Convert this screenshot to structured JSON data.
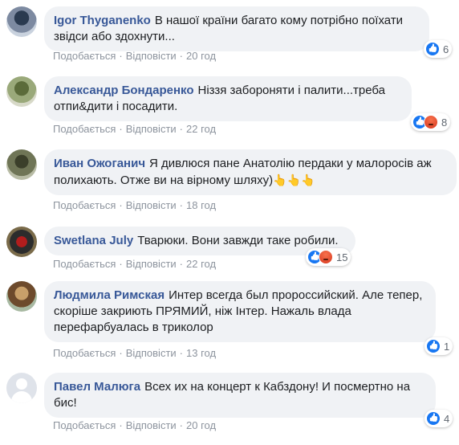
{
  "action_labels": {
    "like": "Подобається",
    "reply": "Відповісти",
    "separator": "·"
  },
  "comments": [
    {
      "author": "Igor Thyganenko",
      "text": "В нашої країни багато кому потрібно поїхати звідси або здохнути...",
      "time": "20 год",
      "reactions": [
        "like"
      ],
      "reaction_count": "6"
    },
    {
      "author": "Александр Бондаренко",
      "text": "Ніззя забороняти і палити...треба отпи&дити і посадити.",
      "time": "22 год",
      "reactions": [
        "like",
        "angry"
      ],
      "reaction_count": "8"
    },
    {
      "author": "Иван Ожоганич",
      "text": "Я дивлюся пане Анатолію пердаки у малоросів аж полихають. Отже ви на вірному шляху)",
      "emoji": "👆👆👆",
      "time": "18 год"
    },
    {
      "author": "Swetlana July",
      "text": "Тварюки. Вони завжди таке робили.",
      "time": "22 год",
      "reactions": [
        "like",
        "angry"
      ],
      "reaction_count": "15"
    },
    {
      "author": "Людмила Римская",
      "text": "Интер всегда был пророссийский. Але тепер, скоріше закриють ПРЯМИЙ, ніж Інтер. Нажаль влада перефарбуалась в триколор",
      "time": "13 год",
      "reactions": [
        "like"
      ],
      "reaction_count": "1"
    },
    {
      "author": "Павел Малюга",
      "text": "Всех их на концерт к Кабздону! И посмертно на бис!",
      "time": "20 год",
      "reactions": [
        "like"
      ],
      "reaction_count": "4"
    }
  ]
}
